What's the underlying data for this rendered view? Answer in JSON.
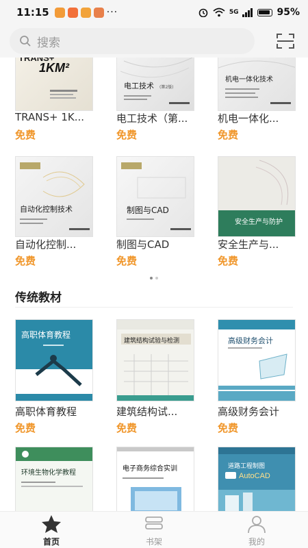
{
  "status_bar": {
    "time": "11:15",
    "more": "···",
    "network": "5G",
    "battery": "95%"
  },
  "search": {
    "placeholder": "搜索"
  },
  "featured": {
    "books": [
      {
        "title": "TRANS+ 1K...",
        "price": "免费",
        "cover_text": "TRANS+ 1KM²"
      },
      {
        "title": "电工技术（第...",
        "price": "免费",
        "cover_text": "电工技术"
      },
      {
        "title": "机电一体化...",
        "price": "免费",
        "cover_text": "机电一体化技术"
      },
      {
        "title": "自动化控制...",
        "price": "免费",
        "cover_text": "自动化控制技术"
      },
      {
        "title": "制图与CAD",
        "price": "免费",
        "cover_text": "制图与CAD"
      },
      {
        "title": "安全生产与...",
        "price": "免费",
        "cover_text": "安全生产与防护"
      }
    ]
  },
  "traditional": {
    "section_title": "传统教材",
    "books": [
      {
        "title": "高职体育教程",
        "price": "免费",
        "cover_text": "高职体育教程"
      },
      {
        "title": "建筑结构试...",
        "price": "免费",
        "cover_text": "建筑结构试验与检测"
      },
      {
        "title": "高级财务会计",
        "price": "免费",
        "cover_text": "高级财务会计"
      },
      {
        "title": "环境生物化学教程",
        "price": "",
        "cover_text": "环境生物化学教程"
      },
      {
        "title": "电子商务综合实训",
        "price": "",
        "cover_text": "电子商务综合实训"
      },
      {
        "title": "道路工程制图与AutoCAD",
        "price": "",
        "cover_text": "道路工程制图与AutoCAD"
      }
    ]
  },
  "bottom_nav": [
    {
      "label": "首页",
      "icon": "star-icon",
      "active": true
    },
    {
      "label": "书架",
      "icon": "bookshelf-icon",
      "active": false
    },
    {
      "label": "我的",
      "icon": "user-icon",
      "active": false
    }
  ],
  "colors": {
    "price": "#f0962a",
    "accent": "#222222"
  }
}
